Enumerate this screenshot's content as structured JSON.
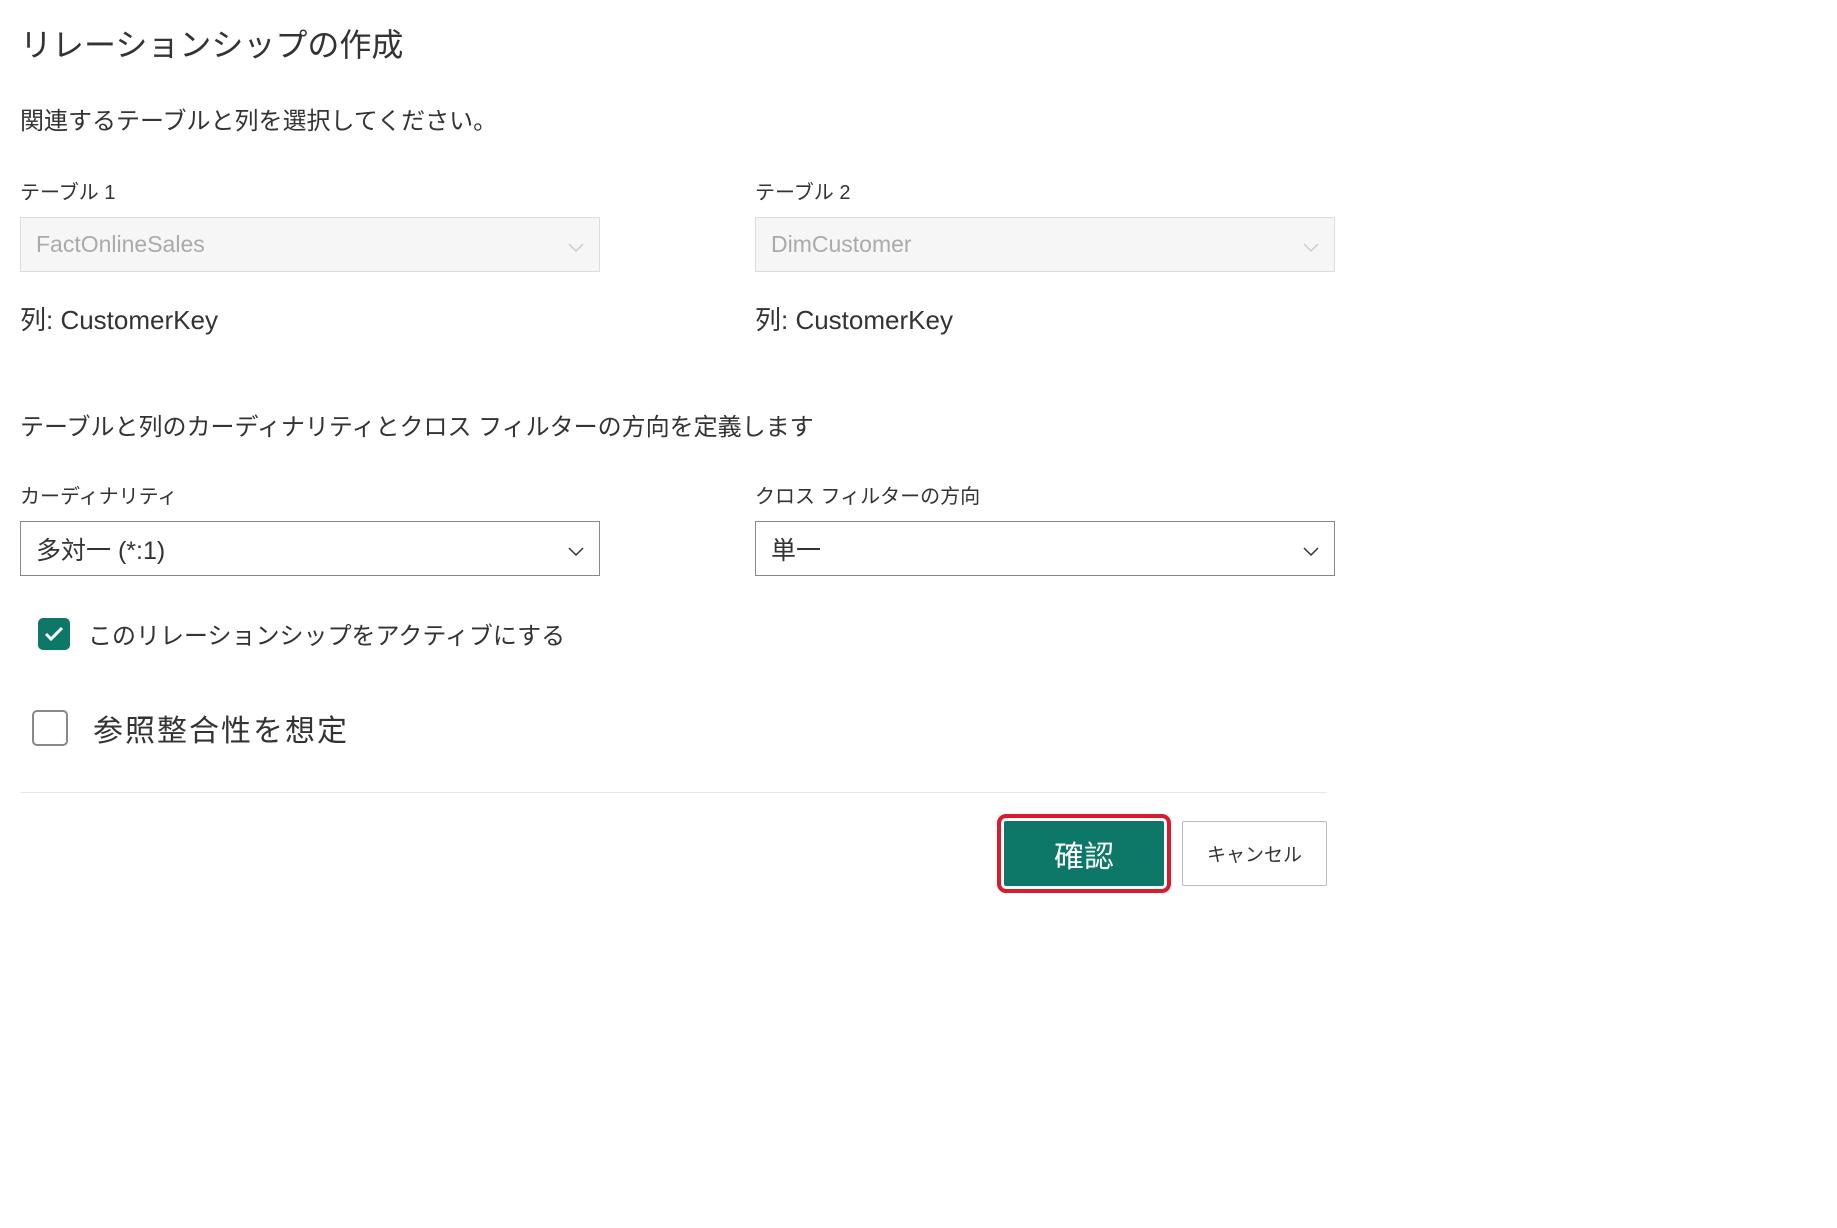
{
  "dialog": {
    "title": "リレーションシップの作成",
    "subtitle": "関連するテーブルと列を選択してください。"
  },
  "table1": {
    "label": "テーブル 1",
    "value": "FactOnlineSales",
    "column": "列: CustomerKey"
  },
  "table2": {
    "label": "テーブル 2",
    "value": "DimCustomer",
    "column": "列: CustomerKey"
  },
  "section": {
    "heading": "テーブルと列のカーディナリティとクロス フィルターの方向を定義します"
  },
  "cardinality": {
    "label": "カーディナリティ",
    "value": "多対一 (*:1)"
  },
  "crossFilter": {
    "label": "クロス フィルターの方向",
    "value": "単一"
  },
  "checkboxes": {
    "active": {
      "label": "このリレーションシップをアクティブにする",
      "checked": true
    },
    "referential": {
      "label": "参照整合性を想定",
      "checked": false
    }
  },
  "footer": {
    "confirm": "確認",
    "cancel": "キャンセル"
  }
}
